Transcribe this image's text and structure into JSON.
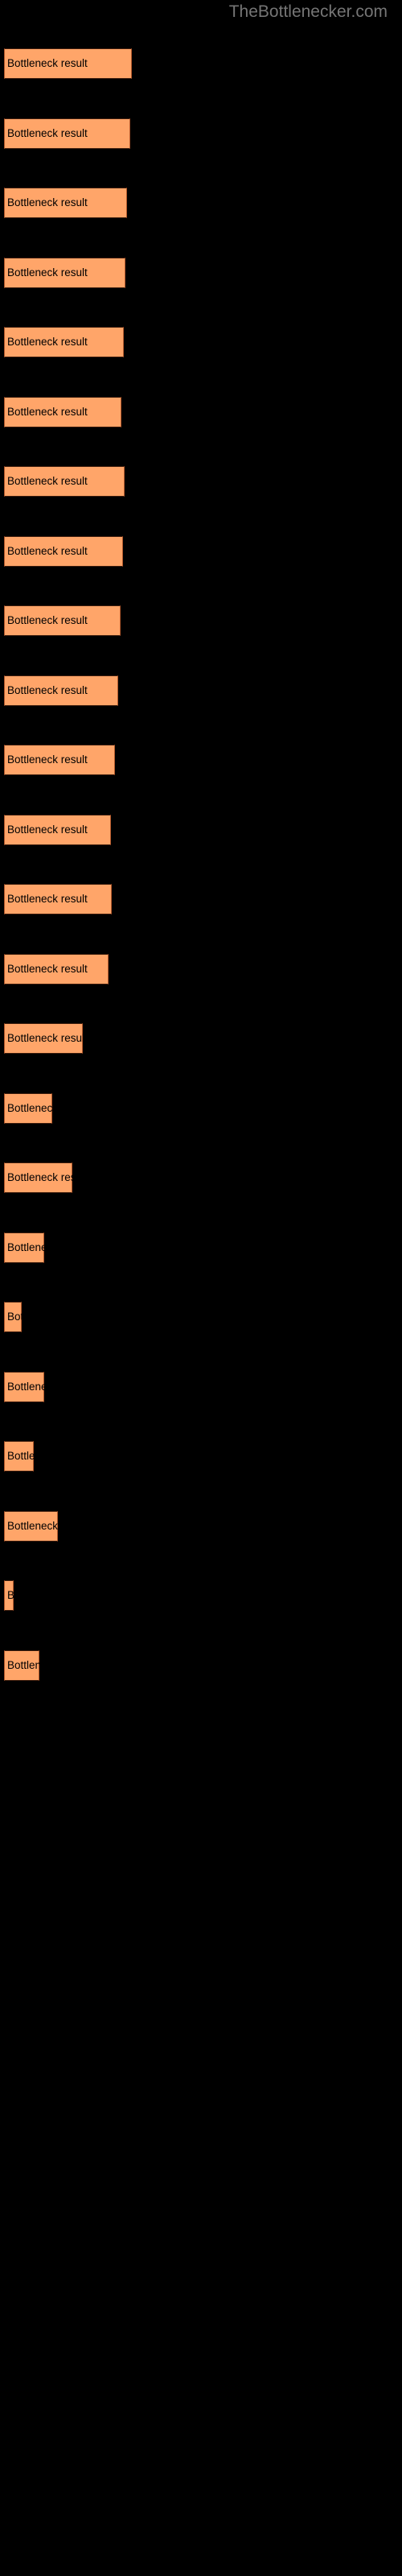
{
  "site": {
    "title": "TheBottlenecker.com",
    "title_color": "#757575",
    "background_color": "#000000"
  },
  "chart_data": {
    "type": "bar",
    "orientation": "horizontal",
    "title": "TheBottlenecker.com",
    "xlabel": "",
    "ylabel": "",
    "grid": false,
    "legend": false,
    "bar_color": "#ffa569",
    "bar_border_color": "#b3592c",
    "label_color": "#000000",
    "categories": [
      "Bottleneck result",
      "Bottleneck result",
      "Bottleneck result",
      "Bottleneck result",
      "Bottleneck result",
      "Bottleneck result",
      "Bottleneck result",
      "Bottleneck result",
      "Bottleneck result",
      "Bottleneck result",
      "Bottleneck result",
      "Bottleneck result",
      "Bottleneck result",
      "Bottleneck result",
      "Bottleneck result",
      "Bottleneck result",
      "Bottleneck result",
      "Bottleneck result",
      "Bottleneck result",
      "Bottleneck result",
      "Bottleneck result",
      "Bottleneck result",
      "Bottleneck result",
      "Bottleneck result"
    ],
    "values": [
      159,
      157,
      153,
      151,
      149,
      146,
      150,
      148,
      145,
      142,
      138,
      133,
      124,
      117,
      110,
      102,
      90,
      72,
      52,
      60,
      47,
      70,
      12,
      48
    ],
    "xlim": [
      0,
      500
    ],
    "bars": [
      {
        "label": "Bottleneck result",
        "width": 159,
        "top": 60
      },
      {
        "label": "Bottleneck result",
        "width": 157,
        "top": 147
      },
      {
        "label": "Bottleneck result",
        "width": 153,
        "top": 233
      },
      {
        "label": "Bottleneck result",
        "width": 151,
        "top": 320
      },
      {
        "label": "Bottleneck result",
        "width": 149,
        "top": 406
      },
      {
        "label": "Bottleneck result",
        "width": 146,
        "top": 493
      },
      {
        "label": "Bottleneck result",
        "width": 150,
        "top": 579
      },
      {
        "label": "Bottleneck result",
        "width": 148,
        "top": 666
      },
      {
        "label": "Bottleneck result",
        "width": 145,
        "top": 752
      },
      {
        "label": "Bottleneck result",
        "width": 142,
        "top": 839
      },
      {
        "label": "Bottleneck result",
        "width": 138,
        "top": 925
      },
      {
        "label": "Bottleneck result",
        "width": 133,
        "top": 1012
      },
      {
        "label": "Bottleneck result",
        "width": 134,
        "top": 1098
      },
      {
        "label": "Bottleneck result",
        "width": 130,
        "top": 1185
      },
      {
        "label": "Bottleneck result",
        "width": 98,
        "top": 1271
      },
      {
        "label": "Bottleneck result",
        "width": 60,
        "top": 1358
      },
      {
        "label": "Bottleneck result",
        "width": 85,
        "top": 1444
      },
      {
        "label": "Bottleneck result",
        "width": 50,
        "top": 1531
      },
      {
        "label": "Bottleneck result",
        "width": 22,
        "top": 1617
      },
      {
        "label": "Bottleneck result",
        "width": 50,
        "top": 1704
      },
      {
        "label": "Bottleneck result",
        "width": 37,
        "top": 1790
      },
      {
        "label": "Bottleneck result",
        "width": 67,
        "top": 1877
      },
      {
        "label": "Bottleneck result",
        "width": 12,
        "top": 1963
      },
      {
        "label": "Bottleneck result",
        "width": 44,
        "top": 2050
      }
    ]
  }
}
